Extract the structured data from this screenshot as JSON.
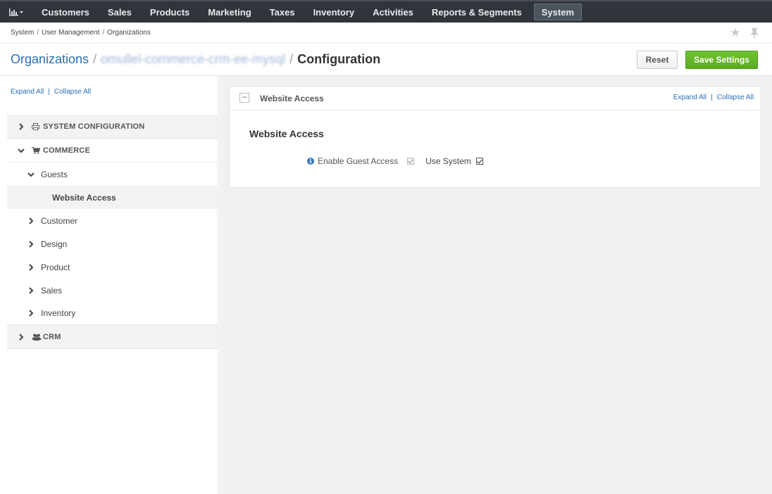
{
  "nav": {
    "logo_icon": "bar-chart-icon",
    "items": [
      {
        "label": "Customers"
      },
      {
        "label": "Sales"
      },
      {
        "label": "Products"
      },
      {
        "label": "Marketing"
      },
      {
        "label": "Taxes"
      },
      {
        "label": "Inventory"
      },
      {
        "label": "Activities"
      },
      {
        "label": "Reports & Segments"
      }
    ],
    "active_item": {
      "label": "System"
    }
  },
  "breadcrumb": {
    "items": [
      "System",
      "User Management",
      "Organizations"
    ],
    "separator": "/"
  },
  "page": {
    "title_link": "Organizations",
    "title_entity": "omullel-commerce-crm-ee-mysql",
    "title_sep": "/",
    "title_current": "Configuration",
    "reset_label": "Reset",
    "save_label": "Save Settings",
    "save_color": "#5eb023"
  },
  "sidebar": {
    "expand_all": "Expand All",
    "collapse_all": "Collapse All",
    "pipe": "|",
    "sections": [
      {
        "label": "SYSTEM CONFIGURATION",
        "icon": "printer-icon"
      },
      {
        "label": "COMMERCE",
        "icon": "cart-icon"
      },
      {
        "label": "CRM",
        "icon": "users-icon"
      }
    ],
    "commerce_items": [
      {
        "label": "Guests"
      },
      {
        "label": "Customer"
      },
      {
        "label": "Design"
      },
      {
        "label": "Product"
      },
      {
        "label": "Sales"
      },
      {
        "label": "Inventory"
      }
    ],
    "active_leaf": "Website Access"
  },
  "main": {
    "panel_title": "Website Access",
    "expand_all": "Expand All",
    "collapse_all": "Collapse All",
    "pipe": "|",
    "fieldset_title": "Website Access",
    "field_label": "Enable Guest Access",
    "use_system_label": "Use System",
    "field_checked": true,
    "use_system_checked": true
  }
}
